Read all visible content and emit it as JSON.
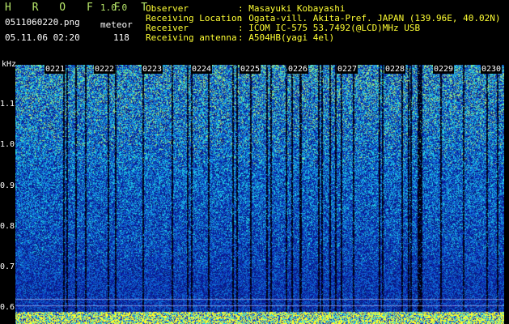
{
  "app": {
    "logo": "H R O F F T",
    "version": "1.0.0",
    "filename": "0511060220.png",
    "datetime": "05.11.06 02:20",
    "mode_label": "meteor",
    "count": "118"
  },
  "info": {
    "labels": [
      "Observer",
      "Receiving Location",
      "Receiver",
      "Receiving antenna"
    ],
    "values": [
      ": Masayuki Kobayashi",
      ": Ogata-vill. Akita-Pref. JAPAN (139.96E, 40.02N)",
      ": ICOM IC-575 53.7492(@LCD)MHz USB",
      ": A504HB(yagi 4el)"
    ]
  },
  "axis": {
    "unit": "kHz",
    "y_ticks": [
      "1.1",
      "1.0",
      "0.9",
      "0.8",
      "0.7",
      "0.6"
    ],
    "y_range": [
      0.6,
      1.15
    ],
    "time_labels": [
      "0221",
      "0222",
      "0223",
      "0224",
      "0225",
      "0226",
      "0227",
      "0228",
      "0229",
      "0230"
    ]
  },
  "colors": {
    "label_green": "#b8e86a",
    "signal_yellow": "#ffff33",
    "noise_blue": "#1428c8"
  }
}
